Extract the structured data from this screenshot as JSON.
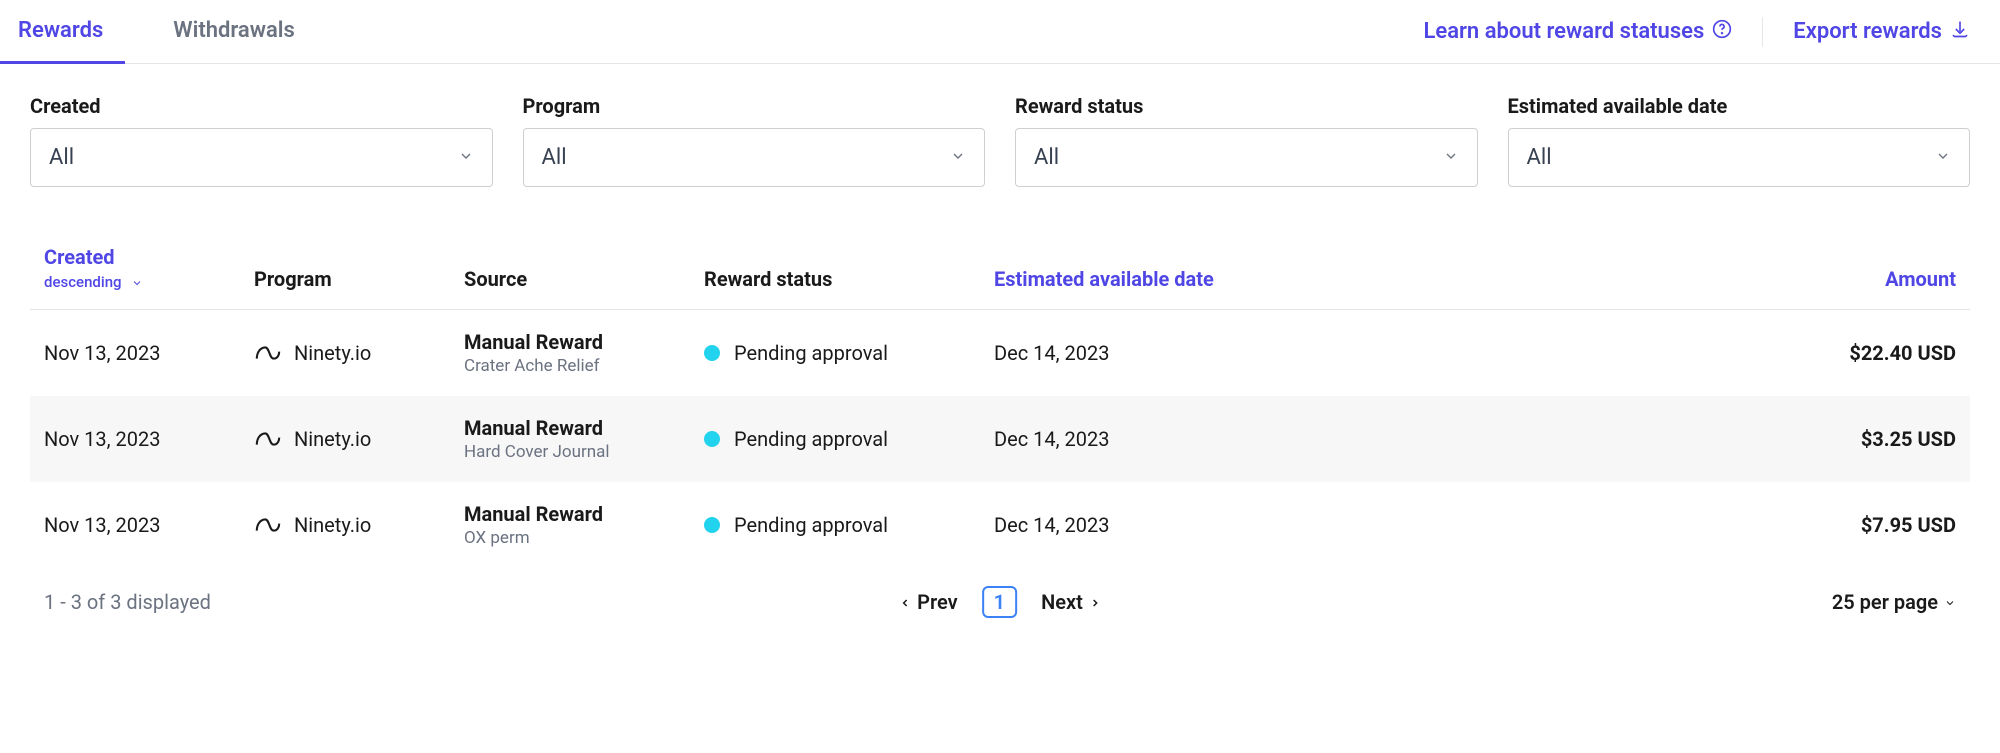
{
  "tabs": {
    "rewards": "Rewards",
    "withdrawals": "Withdrawals"
  },
  "top_links": {
    "learn_statuses": "Learn about reward statuses",
    "export": "Export rewards"
  },
  "filters": {
    "created": {
      "label": "Created",
      "value": "All"
    },
    "program": {
      "label": "Program",
      "value": "All"
    },
    "status": {
      "label": "Reward status",
      "value": "All"
    },
    "date": {
      "label": "Estimated available date",
      "value": "All"
    }
  },
  "columns": {
    "created": "Created",
    "created_sort": "descending",
    "program": "Program",
    "source": "Source",
    "status": "Reward status",
    "date": "Estimated available date",
    "amount": "Amount"
  },
  "rows": [
    {
      "created": "Nov 13, 2023",
      "program": "Ninety.io",
      "source_primary": "Manual Reward",
      "source_secondary": "Crater Ache Relief",
      "status": "Pending approval",
      "date": "Dec 14, 2023",
      "amount": "$22.40 USD"
    },
    {
      "created": "Nov 13, 2023",
      "program": "Ninety.io",
      "source_primary": "Manual Reward",
      "source_secondary": "Hard Cover Journal",
      "status": "Pending approval",
      "date": "Dec 14, 2023",
      "amount": "$3.25 USD"
    },
    {
      "created": "Nov 13, 2023",
      "program": "Ninety.io",
      "source_primary": "Manual Reward",
      "source_secondary": "OX perm",
      "status": "Pending approval",
      "date": "Dec 14, 2023",
      "amount": "$7.95 USD"
    }
  ],
  "pagination": {
    "info": "1 - 3 of 3 displayed",
    "prev": "Prev",
    "next": "Next",
    "current_page": "1",
    "per_page": "25 per page"
  }
}
